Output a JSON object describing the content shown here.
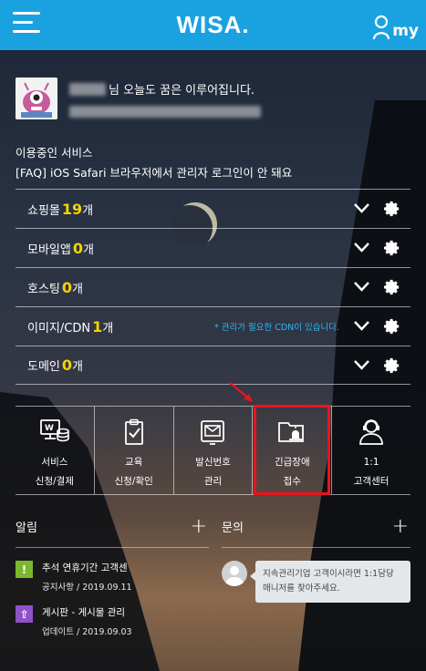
{
  "header": {
    "logo": "WISA.",
    "my_label": "my"
  },
  "user": {
    "greeting": "님 오늘도 꿈은 이루어집니다."
  },
  "services": {
    "title": "이용중인 서비스",
    "notice": "[FAQ] iOS Safari 브라우저에서 관리자 로그인이 안 돼요",
    "items": [
      {
        "name": "쇼핑몰",
        "count": "19",
        "unit": "개",
        "note": ""
      },
      {
        "name": "모바일앱",
        "count": "0",
        "unit": "개",
        "note": ""
      },
      {
        "name": "호스팅",
        "count": "0",
        "unit": "개",
        "note": ""
      },
      {
        "name": "이미지/CDN",
        "count": "1",
        "unit": "개",
        "note": "* 관리가 필요한 CDN이 있습니다."
      },
      {
        "name": "도메인",
        "count": "0",
        "unit": "개",
        "note": ""
      }
    ]
  },
  "quick_menu": [
    {
      "line1": "서비스",
      "line2": "신청/결제",
      "icon": "service-payment-icon"
    },
    {
      "line1": "교육",
      "line2": "신청/확인",
      "icon": "education-clipboard-icon"
    },
    {
      "line1": "발신번호",
      "line2": "관리",
      "icon": "sender-number-icon"
    },
    {
      "line1": "긴급장애",
      "line2": "접수",
      "icon": "emergency-alert-icon"
    },
    {
      "line1": "1:1",
      "line2": "고객센터",
      "icon": "customer-center-icon"
    }
  ],
  "notice_board": {
    "title": "알림",
    "items": [
      {
        "title": "추석 연휴기간 고객센",
        "sub": "공지사항 / 2019.09.11",
        "icon_text": "!",
        "color": "#7cb82f"
      },
      {
        "title": "게시판 - 게시물 관리",
        "sub": "업데이트 / 2019.09.03",
        "icon_text": "⇧",
        "color": "#8e52c9"
      }
    ]
  },
  "inquiry_board": {
    "title": "문의",
    "message": "지속관리기업 고객이시라면 1:1담당 매니저를 찾아주세요."
  },
  "colors": {
    "accent": "#1aa2e0",
    "count": "#f5d300",
    "highlight": "#e8141c",
    "note": "#2fb7ee"
  }
}
